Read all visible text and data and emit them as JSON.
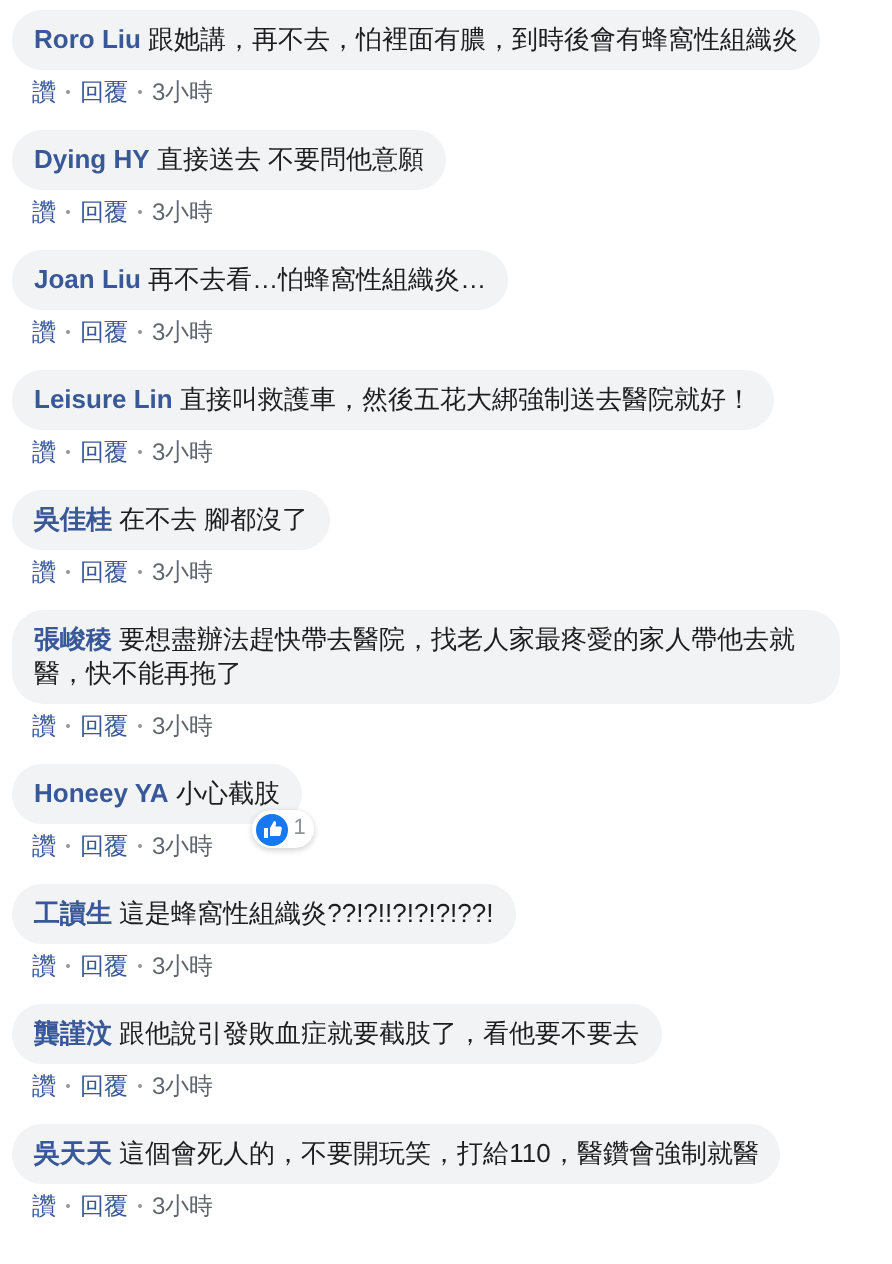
{
  "comments": [
    {
      "author": "Roro Liu",
      "text": "跟她講，再不去，怕裡面有膿，到時後會有蜂窩性組織炎",
      "like": "讚",
      "reply": "回覆",
      "time": "3小時"
    },
    {
      "author": "Dying HY",
      "text": "直接送去 不要問他意願",
      "like": "讚",
      "reply": "回覆",
      "time": "3小時"
    },
    {
      "author": "Joan Liu",
      "text": "再不去看…怕蜂窩性組織炎…",
      "like": "讚",
      "reply": "回覆",
      "time": "3小時"
    },
    {
      "author": "Leisure Lin",
      "text": "直接叫救護車，然後五花大綁強制送去醫院就好！",
      "like": "讚",
      "reply": "回覆",
      "time": "3小時"
    },
    {
      "author": "吳佳桂",
      "text": "在不去 腳都沒了",
      "like": "讚",
      "reply": "回覆",
      "time": "3小時"
    },
    {
      "author": "張峻稜",
      "text": "要想盡辦法趕快帶去醫院，找老人家最疼愛的家人帶他去就醫，快不能再拖了",
      "like": "讚",
      "reply": "回覆",
      "time": "3小時"
    },
    {
      "author": "Honeey YA",
      "text": "小心截肢",
      "like": "讚",
      "reply": "回覆",
      "time": "3小時",
      "reaction_count": "1"
    },
    {
      "author": "工讀生",
      "text": "這是蜂窩性組織炎??!?!!?!?!?!??!",
      "like": "讚",
      "reply": "回覆",
      "time": "3小時"
    },
    {
      "author": "龔謹汶",
      "text": "跟他說引發敗血症就要截肢了，看他要不要去",
      "like": "讚",
      "reply": "回覆",
      "time": "3小時"
    },
    {
      "author": "吳天天",
      "text": "這個會死人的，不要開玩笑，打給110，醫鑽會強制就醫",
      "like": "讚",
      "reply": "回覆",
      "time": "3小時"
    }
  ]
}
